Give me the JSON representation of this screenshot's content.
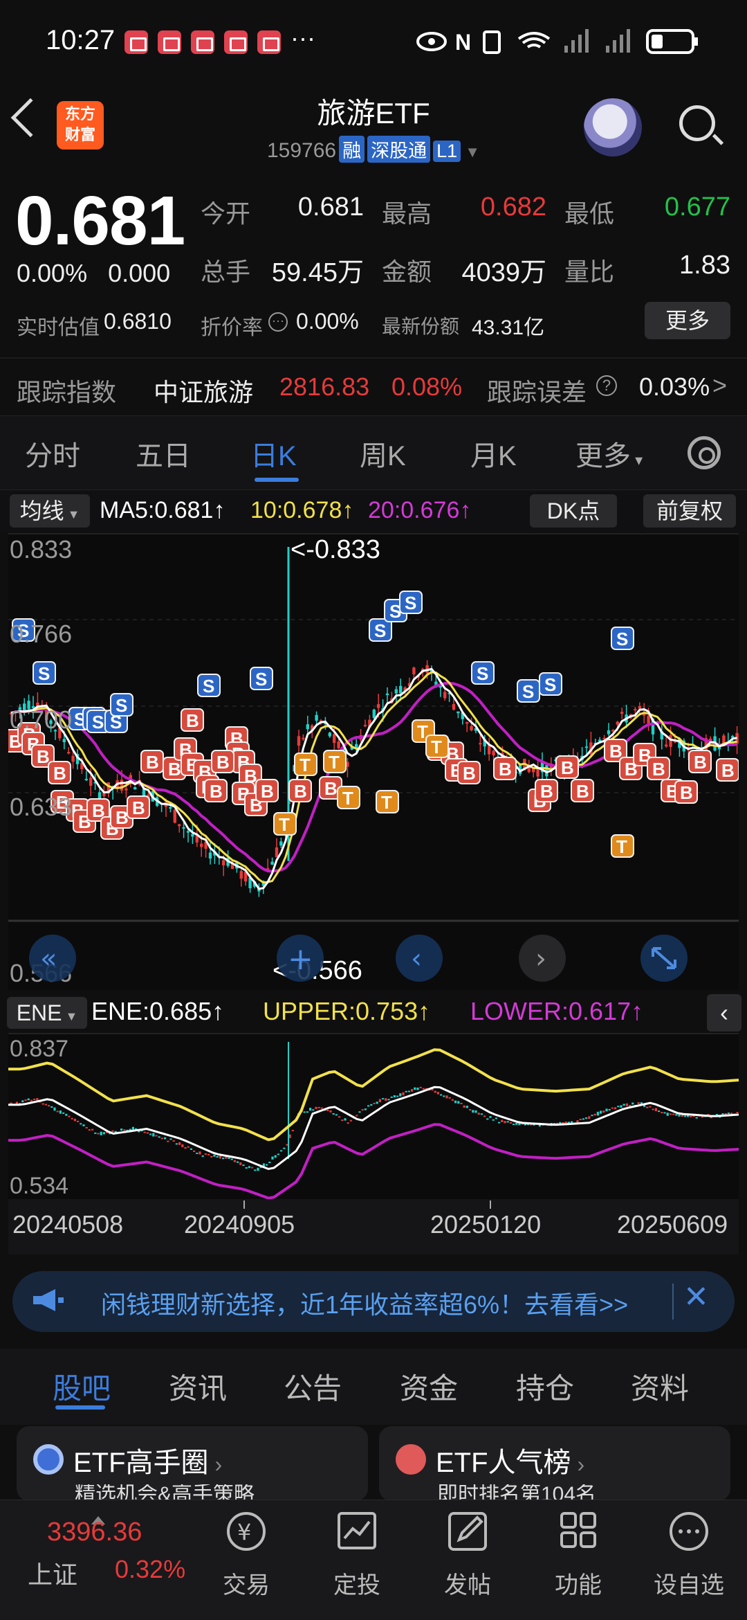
{
  "status_bar": {
    "time": "10:27",
    "dots": "···"
  },
  "header": {
    "logo_line1": "东方",
    "logo_line2": "财富",
    "title": "旅游ETF",
    "code": "159766",
    "tags": [
      "融",
      "深股通",
      "L1"
    ]
  },
  "quote": {
    "price": "0.681",
    "change_pct": "0.00%",
    "change_abs": "0.000",
    "open_label": "今开",
    "open": "0.681",
    "high_label": "最高",
    "high": "0.682",
    "low_label": "最低",
    "low": "0.677",
    "volume_label": "总手",
    "volume": "59.45万",
    "amount_label": "金额",
    "amount": "4039万",
    "ratio_label": "量比",
    "ratio": "1.83",
    "iopv_label": "实时估值",
    "iopv": "0.6810",
    "premium_label": "折价率",
    "premium": "0.00%",
    "shares_label": "最新份额",
    "shares": "43.31亿",
    "more": "更多"
  },
  "tracking": {
    "label": "跟踪指数",
    "index_name": "中证旅游",
    "index_value": "2816.83",
    "index_change": "0.08%",
    "error_label": "跟踪误差",
    "error_value": "0.03%"
  },
  "tabs": [
    "分时",
    "五日",
    "日K",
    "周K",
    "月K",
    "更多"
  ],
  "active_tab": "日K",
  "ma_row": {
    "selector": "均线",
    "ma5": "MA5:0.681↑",
    "ma10": "10:0.678↑",
    "ma20": "20:0.676↑",
    "dk_button": "DK点",
    "fq_button": "前复权"
  },
  "kchart": {
    "y_top": "0.833",
    "y_2": "0.766",
    "y_3": "0.700",
    "y_4": "0.633",
    "y_bottom": "0.566",
    "high_marker": "<-0.833",
    "low_marker": "<-0.566"
  },
  "ene_row": {
    "selector": "ENE",
    "ene": "ENE:0.685↑",
    "upper": "UPPER:0.753↑",
    "lower": "LOWER:0.617↑"
  },
  "enechart": {
    "y_top": "0.837",
    "y_bottom": "0.534"
  },
  "dates": [
    "20240508",
    "20240905",
    "20250120",
    "20250609"
  ],
  "colors": {
    "up": "#e83a3a",
    "down": "#1fd1c8",
    "ma5": "#ffffff",
    "ma10": "#f2e14a",
    "ma20": "#c21fc4",
    "accent": "#3b7ddd"
  },
  "ad": {
    "text": "闲钱理财新选择，近1年收益率超6%！去看看>>"
  },
  "section_tabs": [
    "股吧",
    "资讯",
    "公告",
    "资金",
    "持仓",
    "资料"
  ],
  "cards": [
    {
      "title": "ETF高手圈",
      "sub": "精选机会&高手策略"
    },
    {
      "title": "ETF人气榜",
      "sub": "即时排名第104名"
    }
  ],
  "nav": {
    "index_value": "3396.36",
    "index_name": "上证",
    "index_change": "0.32%",
    "items": [
      "交易",
      "定投",
      "发帖",
      "功能",
      "设自选"
    ]
  }
}
